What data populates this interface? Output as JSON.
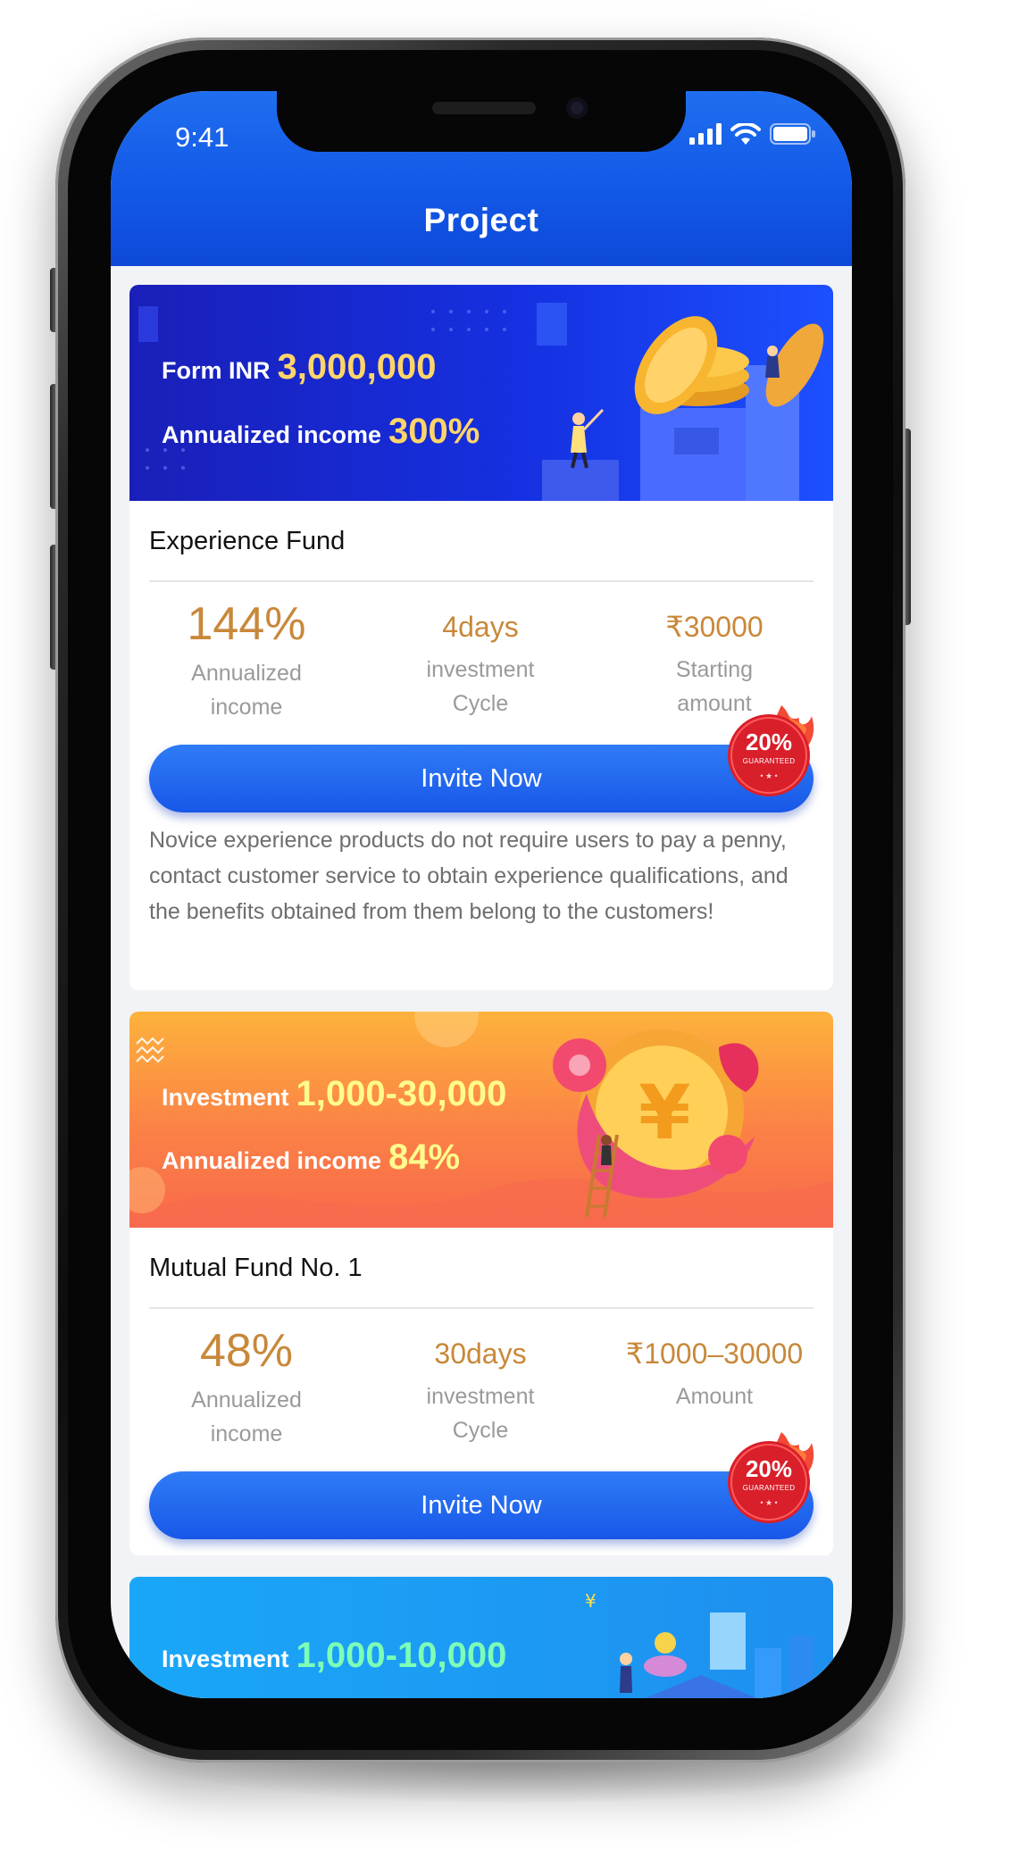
{
  "status_bar": {
    "time": "9:41"
  },
  "header": {
    "title": "Project"
  },
  "funds": [
    {
      "banner": {
        "line1_label": "Form INR",
        "line1_value": "3,000,000",
        "line2_label": "Annualized income",
        "line2_value": "300%"
      },
      "name": "Experience Fund",
      "stats": [
        {
          "value": "144%",
          "caption1": "Annualized",
          "caption2": "income"
        },
        {
          "value": "4days",
          "caption1": "investment",
          "caption2": "Cycle"
        },
        {
          "value": "₹30000",
          "caption1": "Starting",
          "caption2": "amount"
        }
      ],
      "button_label": "Invite Now",
      "badge": {
        "percent": "20%",
        "text": "GUARANTEED"
      },
      "description": "Novice experience products do not require users to pay a penny, contact customer service to obtain experience qualifications, and the benefits obtained from them belong to the customers!"
    },
    {
      "banner": {
        "line1_label": "Investment",
        "line1_value": "1,000-30,000",
        "line2_label": "Annualized  income",
        "line2_value": "84%"
      },
      "name": "Mutual Fund No. 1",
      "stats": [
        {
          "value": "48%",
          "caption1": "Annualized",
          "caption2": "income"
        },
        {
          "value": "30days",
          "caption1": "investment",
          "caption2": "Cycle"
        },
        {
          "value": "₹1000–30000",
          "caption1": "Amount",
          "caption2": ""
        }
      ],
      "button_label": "Invite Now",
      "badge": {
        "percent": "20%",
        "text": "GUARANTEED"
      }
    },
    {
      "banner": {
        "line1_label": "Investment",
        "line1_value": "1,000-10,000"
      }
    }
  ],
  "colors": {
    "header_blue": "#1257e6",
    "accent_gold": "#c8883a",
    "button_blue": "#1857e8",
    "badge_red": "#d8202a"
  }
}
